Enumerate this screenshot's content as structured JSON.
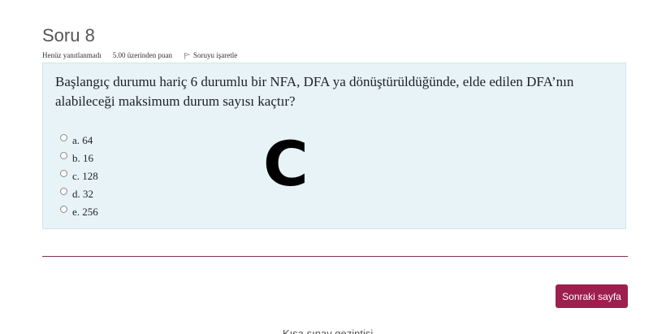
{
  "question": {
    "title": "Soru 8",
    "status": "Henüz yanıtlanmadı",
    "grade": "5.00 üzerinden puan",
    "flag_label": "Soruyu işaretle",
    "flag_icon": "flag-icon",
    "text": "Başlangıç durumu hariç 6 durumlu bir NFA, DFA ya dönüştürüldüğünde, elde edilen DFA’nın alabileceği maksimum durum sayısı kaçtır?",
    "options": [
      {
        "label": "a. 64"
      },
      {
        "label": "b. 16"
      },
      {
        "label": "c. 128"
      },
      {
        "label": "d. 32"
      },
      {
        "label": "e. 256"
      }
    ],
    "handwritten_mark": "C"
  },
  "navigation": {
    "next_label": "Sonraki sayfa",
    "quiz_nav_label": "Kısa sınav gezintisi"
  },
  "colors": {
    "question_box_bg": "#e7f3f6",
    "accent": "#9d1f4d",
    "divider": "#7a3456"
  }
}
